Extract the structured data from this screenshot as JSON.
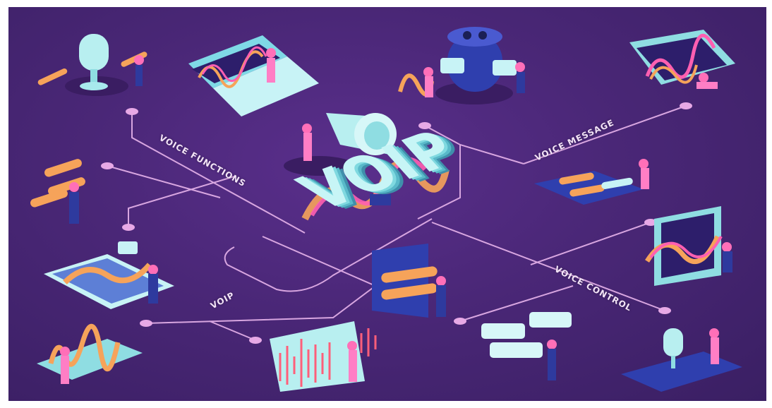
{
  "title": "VOIP",
  "labels": {
    "voice_functions": "VOICE FUNCTIONS",
    "voice_message": "VOICE MESSAGE",
    "voip": "VOIP",
    "voice_control": "VOICE CONTROL"
  },
  "colors": {
    "background": "#4a2777",
    "line": "#e6b3e8",
    "accent_cyan": "#8ee8ef",
    "accent_orange": "#f6a35a",
    "accent_pink": "#ff5fb1"
  },
  "icons": [
    "microphone-icon",
    "laptop-icon",
    "smart-speaker-icon",
    "phone-icon",
    "megaphone-icon",
    "tablet-icon",
    "audio-wave-icon",
    "chat-bubble-icon"
  ]
}
